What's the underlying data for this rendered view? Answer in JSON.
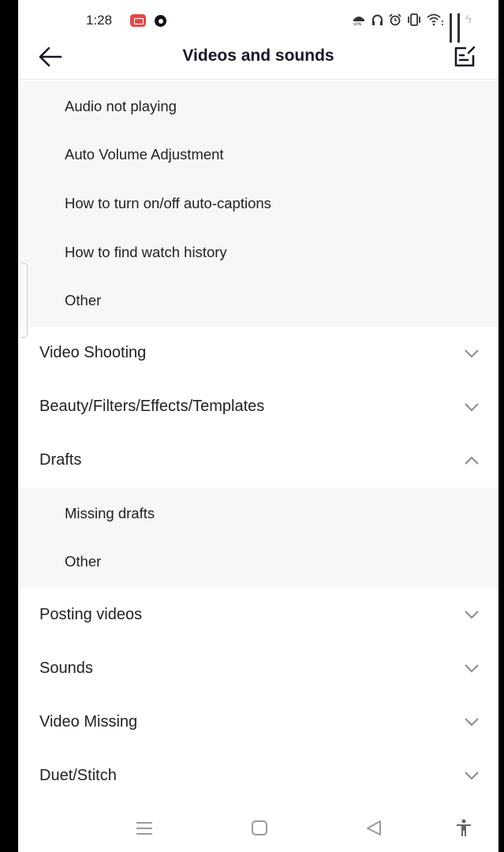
{
  "status_bar": {
    "time": "1:28",
    "left_icons": [
      "screen-recorder-icon",
      "chrome-icon"
    ],
    "right_icons": [
      "vpn-icon",
      "headphones-icon",
      "alarm-icon",
      "vibrate-icon",
      "wifi-icon",
      "signal-icon",
      "signal-icon",
      "charging-icon"
    ]
  },
  "header": {
    "title": "Videos and sounds",
    "back_icon": "arrow-left-icon",
    "edit_icon": "edit-feedback-icon"
  },
  "top_subitems": [
    {
      "label": "Audio not playing"
    },
    {
      "label": "Auto Volume Adjustment"
    },
    {
      "label": "How to turn on/off auto-captions"
    },
    {
      "label": "How to find watch history"
    },
    {
      "label": "Other"
    }
  ],
  "sections": [
    {
      "label": "Video Shooting",
      "expanded": false
    },
    {
      "label": "Beauty/Filters/Effects/Templates",
      "expanded": false
    },
    {
      "label": "Drafts",
      "expanded": true,
      "subitems": [
        {
          "label": "Missing drafts"
        },
        {
          "label": "Other"
        }
      ]
    },
    {
      "label": "Posting videos",
      "expanded": false
    },
    {
      "label": "Sounds",
      "expanded": false
    },
    {
      "label": "Video Missing",
      "expanded": false
    },
    {
      "label": "Duet/Stitch",
      "expanded": false
    }
  ],
  "nav_bar": {
    "buttons": [
      "recents-icon",
      "home-icon",
      "back-icon",
      "accessibility-icon"
    ]
  },
  "colors": {
    "text": "#222222",
    "title": "#161823",
    "subgroup_bg": "#f7f7f7",
    "divider": "#e6e6e6",
    "chevron": "#8a8a8a",
    "recorder_red": "#e64848"
  }
}
